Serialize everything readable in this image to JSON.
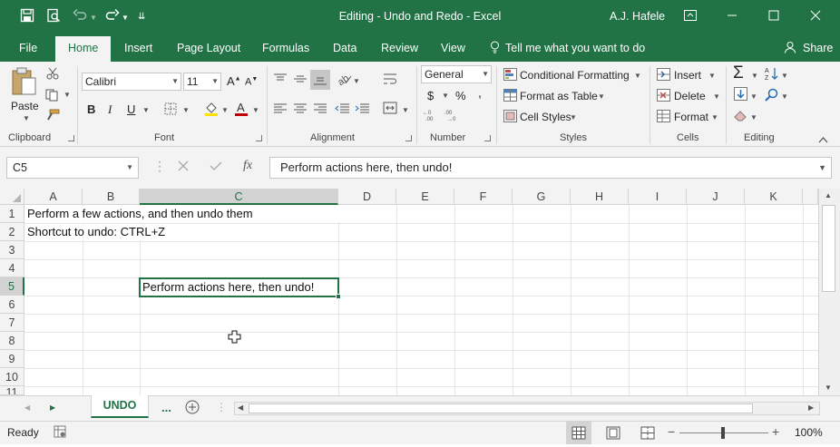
{
  "titlebar": {
    "title": "Editing - Undo and Redo  -  Excel",
    "user": "A.J. Hafele"
  },
  "tabs": [
    "File",
    "Home",
    "Insert",
    "Page Layout",
    "Formulas",
    "Data",
    "Review",
    "View"
  ],
  "tell_me": "Tell me what you want to do",
  "share": "Share",
  "ribbon": {
    "clipboard": {
      "paste": "Paste",
      "group": "Clipboard"
    },
    "font": {
      "name": "Calibri",
      "size": "11",
      "group": "Font",
      "bold": "B",
      "italic": "I",
      "underline": "U"
    },
    "alignment": {
      "group": "Alignment"
    },
    "number": {
      "format": "General",
      "group": "Number",
      "currency": "$",
      "percent": "%",
      "comma": ","
    },
    "styles": {
      "conditional": "Conditional Formatting",
      "table": "Format as Table",
      "cell_styles": "Cell Styles",
      "group": "Styles"
    },
    "cells": {
      "insert": "Insert",
      "delete": "Delete",
      "format": "Format",
      "group": "Cells"
    },
    "editing": {
      "group": "Editing"
    }
  },
  "formula_bar": {
    "name_box": "C5",
    "content": "Perform actions here, then undo!",
    "fx": "fx"
  },
  "columns": [
    "A",
    "B",
    "C",
    "D",
    "E",
    "F",
    "G",
    "H",
    "I",
    "J",
    "K"
  ],
  "rows": [
    "1",
    "2",
    "3",
    "4",
    "5",
    "6",
    "7",
    "8",
    "9",
    "10",
    "11"
  ],
  "cells": {
    "A1": "Perform a few actions, and then undo them",
    "A2": "Shortcut to undo: CTRL+Z",
    "C5": "Perform actions here, then undo!"
  },
  "sheets": {
    "active": "UNDO",
    "more": "..."
  },
  "status": {
    "ready": "Ready",
    "zoom": "100%"
  },
  "colors": {
    "accent": "#217346"
  }
}
